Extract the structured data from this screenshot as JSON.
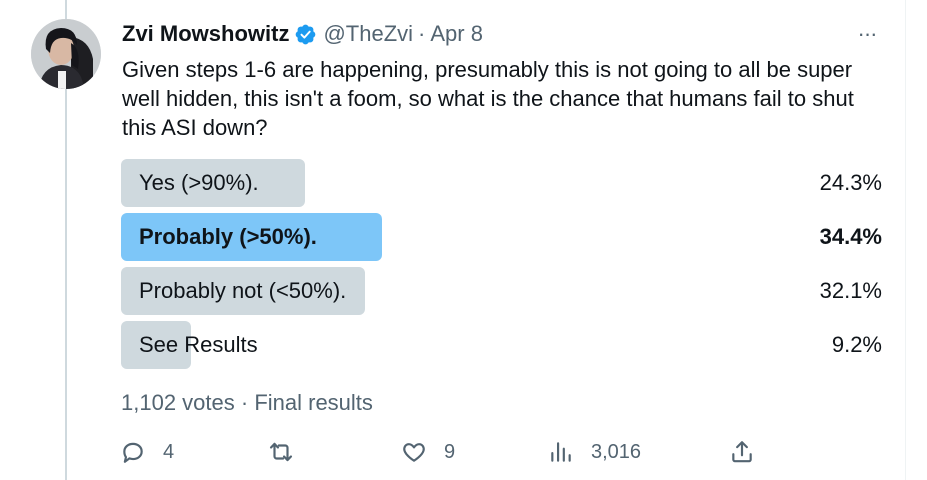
{
  "author": {
    "name": "Zvi Mowshowitz",
    "handle": "@TheZvi",
    "separator": "·",
    "date": "Apr 8",
    "avatar_icon": "profile-photo",
    "verified_icon": "verified-badge-icon"
  },
  "more_label": "···",
  "tweet_text": "Given steps 1-6 are happening, presumably this is not going to all be super well hidden, this isn't a foom, so what is the chance that humans fail to shut this ASI down?",
  "poll": {
    "options": [
      {
        "label": "Yes (>90%).",
        "percent": "24.3%",
        "value": 24.3,
        "winner": false
      },
      {
        "label": "Probably (>50%).",
        "percent": "34.4%",
        "value": 34.4,
        "winner": true
      },
      {
        "label": "Probably not (<50%).",
        "percent": "32.1%",
        "value": 32.1,
        "winner": false
      },
      {
        "label": "See Results",
        "percent": "9.2%",
        "value": 9.2,
        "winner": false
      }
    ],
    "votes": "1,102 votes",
    "separator": "·",
    "status": "Final results"
  },
  "actions": {
    "reply": {
      "icon": "reply-icon",
      "count": "4"
    },
    "retweet": {
      "icon": "retweet-icon",
      "count": ""
    },
    "like": {
      "icon": "heart-icon",
      "count": "9"
    },
    "views": {
      "icon": "views-icon",
      "count": "3,016"
    },
    "share": {
      "icon": "share-icon",
      "count": ""
    }
  },
  "colors": {
    "text": "#0f1419",
    "secondary": "#536471",
    "poll_bar": "#cfd9de",
    "poll_winner": "#7dc6f8",
    "verified": "#1d9bf0"
  }
}
